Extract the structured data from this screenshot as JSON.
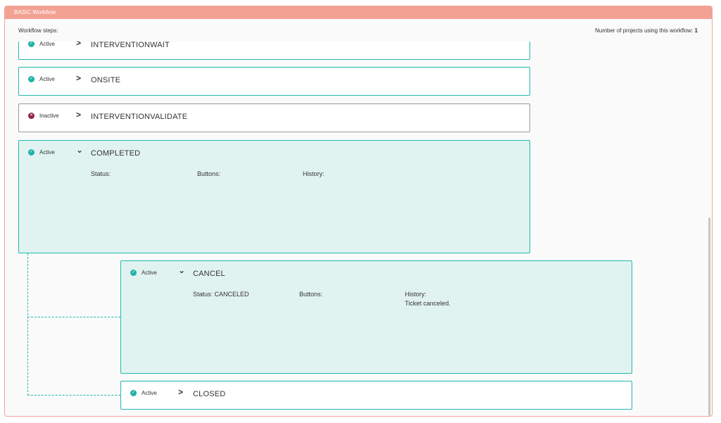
{
  "panel": {
    "title": "BASIC Workflow",
    "steps_label": "Workflow steps:",
    "projects_label": "Number of projects using this workflow:",
    "projects_count": "1"
  },
  "steps": [
    {
      "state": "Active",
      "name": "INTERVENTIONWAIT"
    },
    {
      "state": "Active",
      "name": "ONSITE"
    },
    {
      "state": "Inactive",
      "name": "INTERVENTIONVALIDATE"
    },
    {
      "state": "Active",
      "name": "COMPLETED",
      "status_label": "Status:",
      "buttons_label": "Buttons:",
      "history_label": "History:"
    },
    {
      "state": "Active",
      "name": "CANCEL",
      "status_label": "Status: CANCELED",
      "buttons_label": "Buttons:",
      "history_label": "History:",
      "history_value": "Ticket canceled."
    },
    {
      "state": "Active",
      "name": "CLOSED"
    }
  ],
  "icons": {
    "active": "check-circle-icon",
    "inactive": "x-circle-icon",
    "collapsed": "chevron-right-icon",
    "expanded": "chevron-down-icon"
  },
  "colors": {
    "header": "#f2a193",
    "active": "#20b2a6",
    "inactive": "#8a2342",
    "expanded_bg": "#e1f3f0"
  }
}
